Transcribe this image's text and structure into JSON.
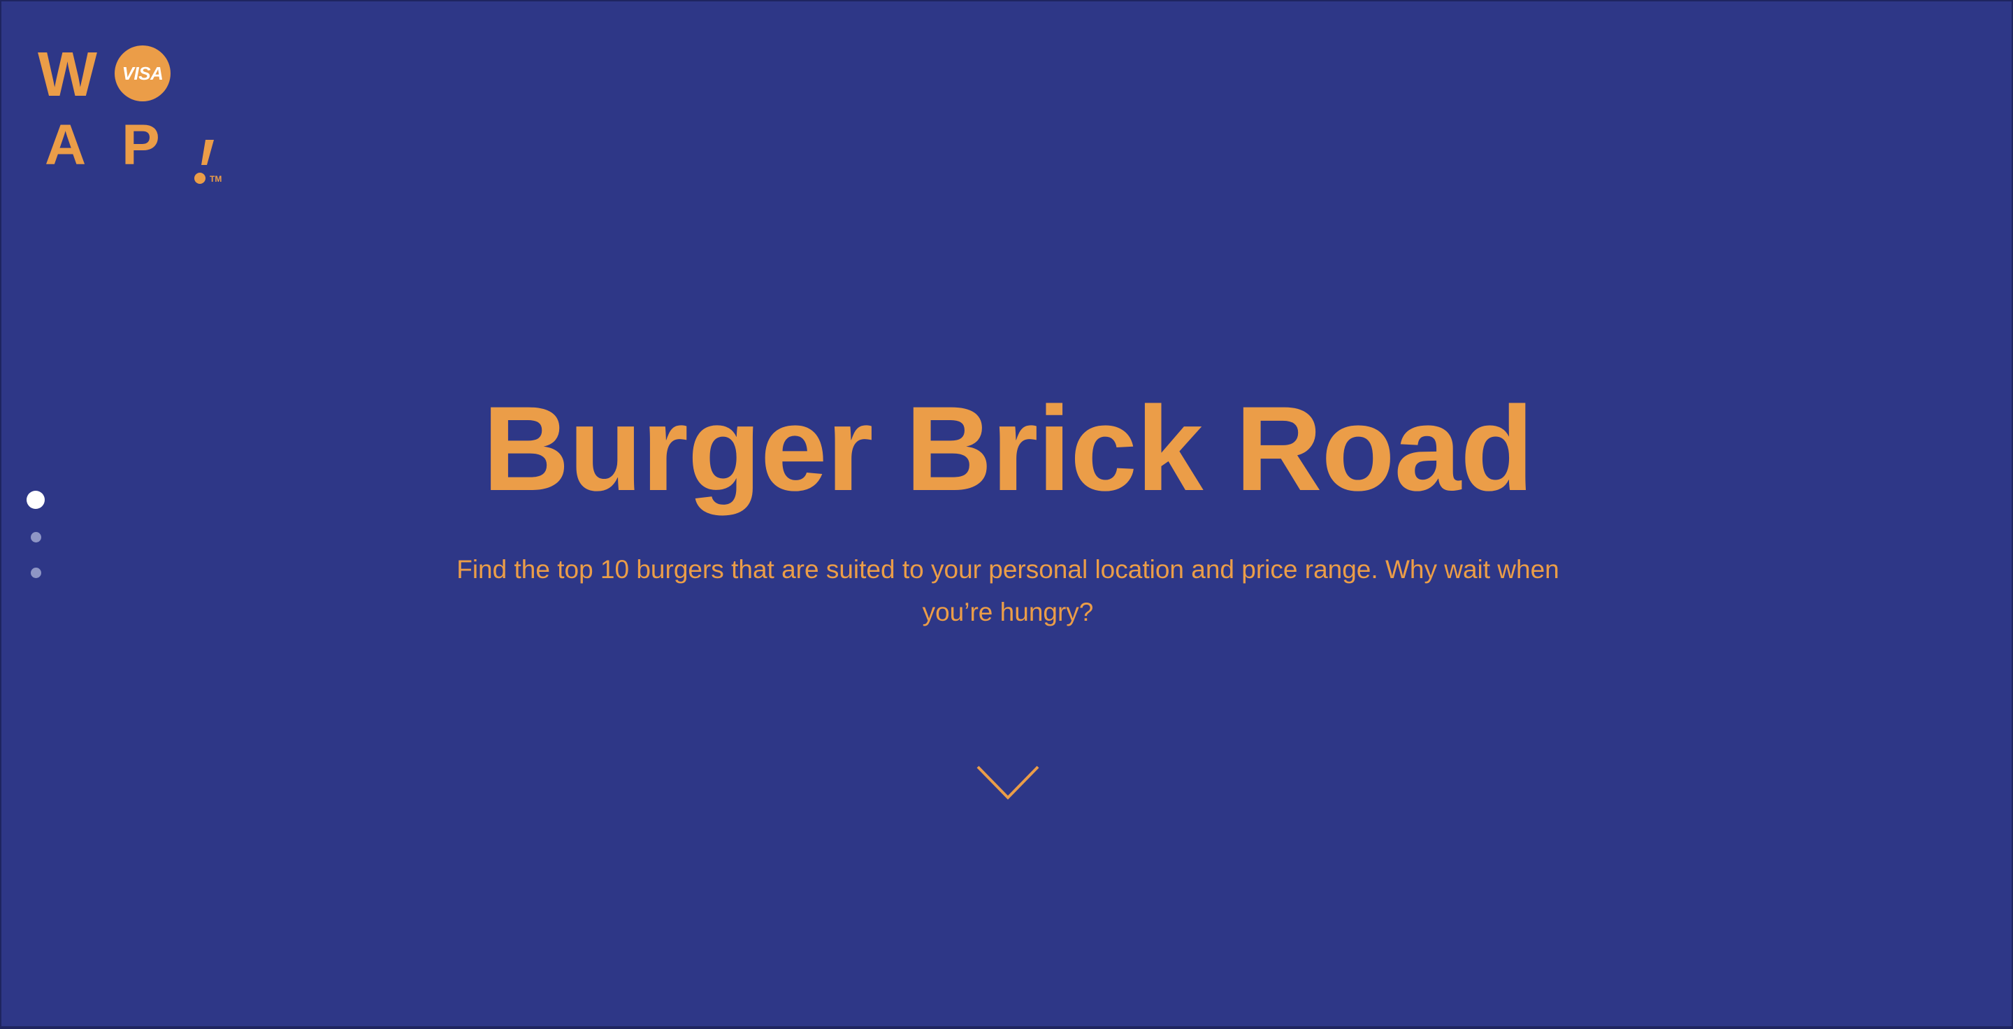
{
  "logo": {
    "letters": {
      "w": "W",
      "a": "A",
      "p": "P"
    },
    "badge_text": "VISA",
    "trademark": "TM",
    "brand_color": "#eb9d48"
  },
  "pagination": {
    "dots": [
      {
        "state": "active"
      },
      {
        "state": "inactive"
      },
      {
        "state": "inactive"
      }
    ]
  },
  "hero": {
    "title": "Burger Brick Road",
    "subtitle": "Find the top 10 burgers that are suited to your personal location and price range. Why wait when you’re hungry?",
    "scroll_icon": "chevron-down-icon"
  },
  "colors": {
    "background": "#2e3787",
    "accent": "#eb9d48",
    "dot_active": "#ffffff",
    "dot_inactive": "#8f96c5"
  }
}
